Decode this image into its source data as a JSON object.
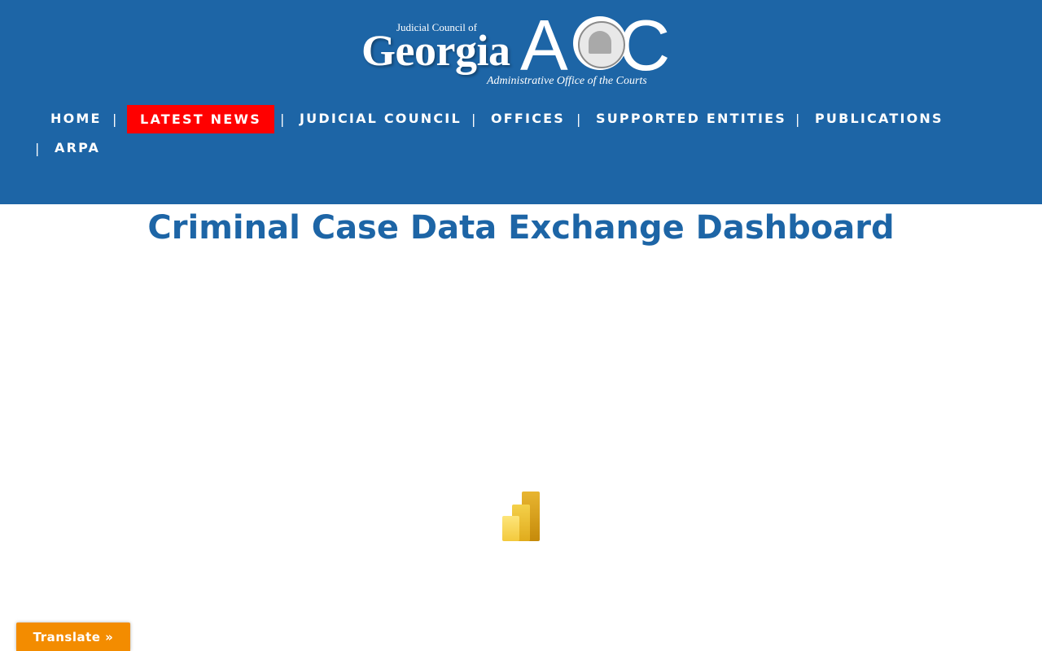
{
  "logo": {
    "small": "Judicial Council of",
    "georgia": "Georgia",
    "aoc_a": "A",
    "aoc_c": "C",
    "tagline": "Administrative Office of the Courts"
  },
  "nav": {
    "items": [
      "HOME",
      "LATEST NEWS",
      "JUDICIAL COUNCIL",
      "OFFICES",
      "SUPPORTED ENTITIES",
      "PUBLICATIONS",
      "ARPA"
    ],
    "separator": "|",
    "highlight_color": "#ff0000"
  },
  "page": {
    "title": "Criminal Case Data Exchange Dashboard"
  },
  "embed": {
    "icon": "power-bi-loading-icon"
  },
  "translate": {
    "label": "Translate »"
  },
  "colors": {
    "header_bg": "#1d65a6",
    "title": "#1d65a6",
    "translate_bg": "#f38c00"
  }
}
